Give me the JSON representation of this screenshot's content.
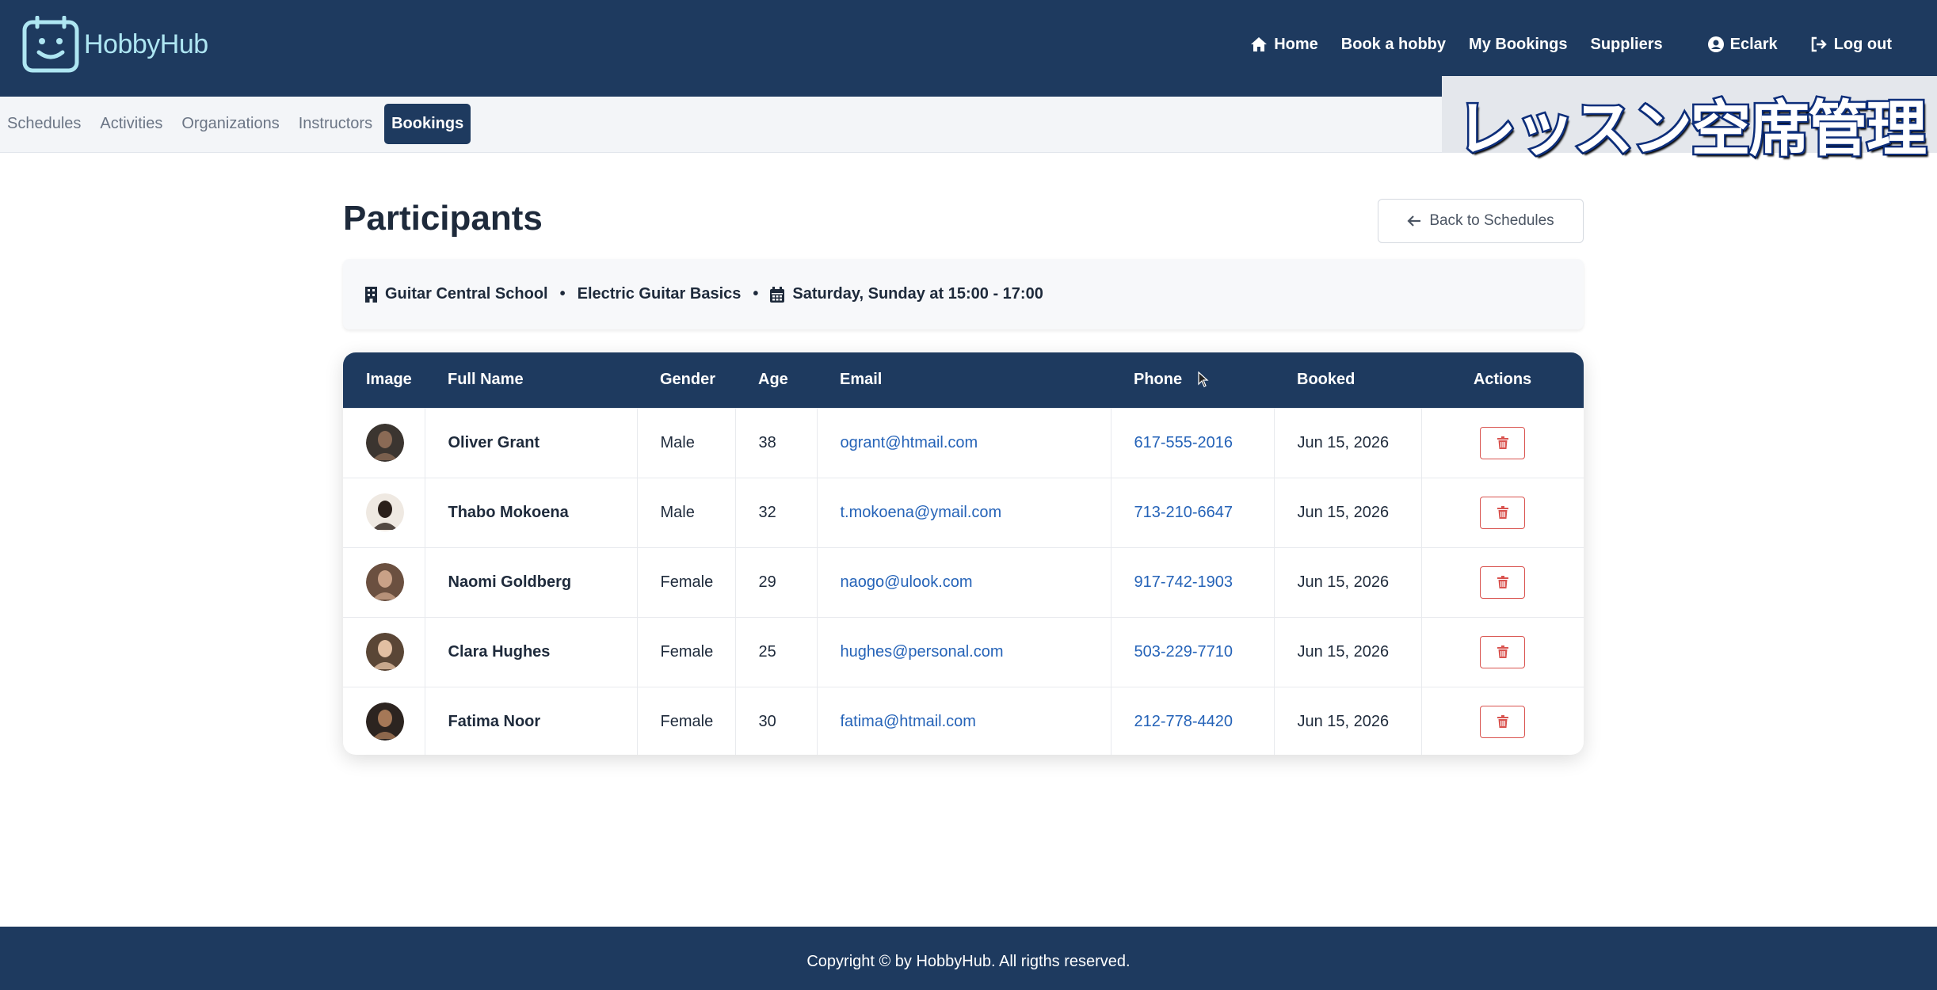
{
  "brand": {
    "name": "HobbyHub",
    "icon": "smiley-calendar-icon"
  },
  "nav": {
    "home": "Home",
    "book": "Book a hobby",
    "my_bookings": "My Bookings",
    "suppliers": "Suppliers",
    "user": "Eclark",
    "logout": "Log out"
  },
  "subnav": {
    "tabs": [
      "Schedules",
      "Activities",
      "Organizations",
      "Instructors",
      "Bookings"
    ],
    "active": "Bookings"
  },
  "overlay_caption": "レッスン空席管理",
  "page": {
    "title": "Participants",
    "back_label": "Back to Schedules"
  },
  "info": {
    "organization": "Guitar Central School",
    "separator": "•",
    "activity": "Electric Guitar Basics",
    "schedule": "Saturday, Sunday at 15:00 - 17:00"
  },
  "table": {
    "headers": {
      "image": "Image",
      "name": "Full Name",
      "gender": "Gender",
      "age": "Age",
      "email": "Email",
      "phone": "Phone",
      "booked": "Booked",
      "actions": "Actions"
    },
    "rows": [
      {
        "name": "Oliver Grant",
        "gender": "Male",
        "age": "38",
        "email": "ogrant@htmail.com",
        "phone": "617-555-2016",
        "booked": "Jun 15, 2026"
      },
      {
        "name": "Thabo Mokoena",
        "gender": "Male",
        "age": "32",
        "email": "t.mokoena@ymail.com",
        "phone": "713-210-6647",
        "booked": "Jun 15, 2026"
      },
      {
        "name": "Naomi Goldberg",
        "gender": "Female",
        "age": "29",
        "email": "naogo@ulook.com",
        "phone": "917-742-1903",
        "booked": "Jun 15, 2026"
      },
      {
        "name": "Clara Hughes",
        "gender": "Female",
        "age": "25",
        "email": "hughes@personal.com",
        "phone": "503-229-7710",
        "booked": "Jun 15, 2026"
      },
      {
        "name": "Fatima Noor",
        "gender": "Female",
        "age": "30",
        "email": "fatima@htmail.com",
        "phone": "212-778-4420",
        "booked": "Jun 15, 2026"
      }
    ]
  },
  "footer": "Copyright © by HobbyHub. All rigths reserved.",
  "colors": {
    "primary": "#1e3a5f",
    "link": "#2563b8",
    "danger": "#d9534f",
    "brand_text": "#aee6f2"
  }
}
